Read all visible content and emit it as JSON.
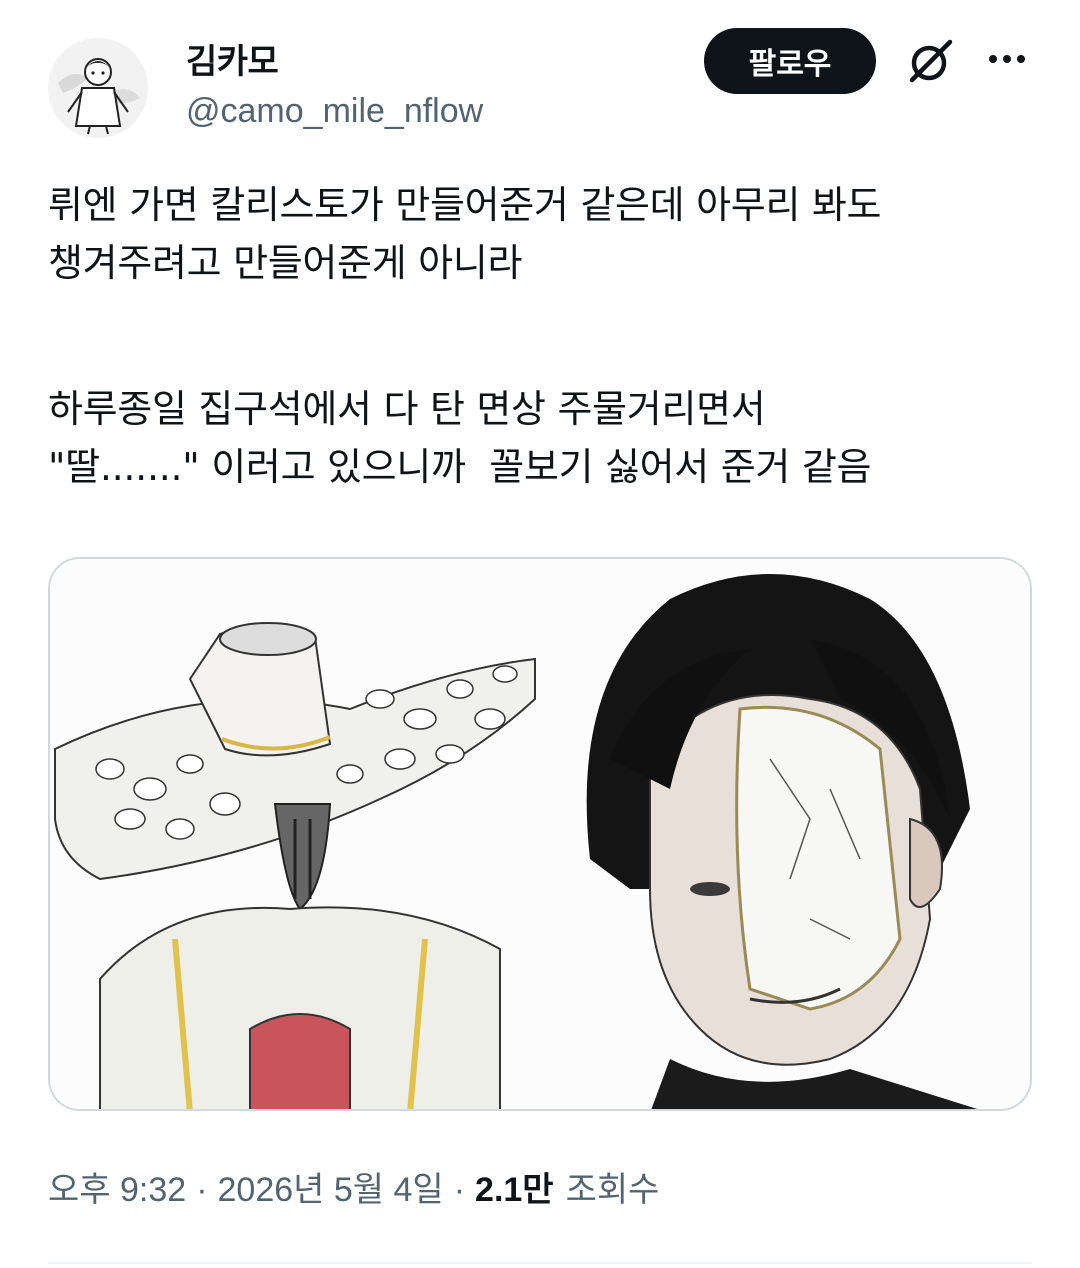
{
  "author": {
    "display_name": "김카모",
    "handle": "@camo_mile_nflow"
  },
  "actions": {
    "follow_label": "팔로우",
    "grok_icon": "grok-icon",
    "more_icon": "more-icon"
  },
  "tweet": {
    "lines": [
      "뤼엔 가면 칼리스토가 만들어준거 같은데 아무리 봐도",
      "챙겨주려고 만들어준게 아니라",
      "하루종일 집구석에서 다 탄 면상 주물거리면서",
      "\"딸.......\" 이러고 있으니까  꼴보기 싫어서 준거 같음"
    ]
  },
  "meta": {
    "time": "오후 9:32",
    "date": "2026년 5월 4일",
    "separator": "·",
    "views_count": "2.1만",
    "views_label": "조회수"
  },
  "colors": {
    "text": "#0f1419",
    "secondary": "#536471",
    "border": "#cfd9de",
    "button_bg": "#0f1419"
  }
}
